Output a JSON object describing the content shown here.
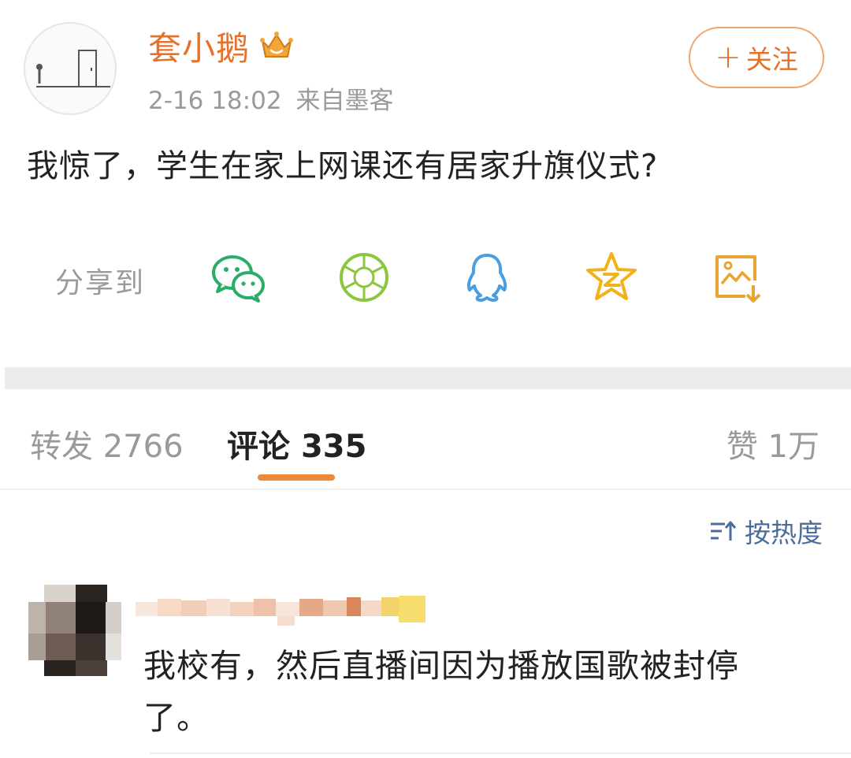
{
  "post": {
    "username": "套小鹅",
    "date": "2-16 18:02",
    "source": "来自墨客",
    "follow_label": "关注",
    "text": "我惊了，学生在家上网课还有居家升旗仪式?",
    "share_label": "分享到",
    "share_targets": [
      "wechat-icon",
      "moments-icon",
      "qq-icon",
      "qzone-icon",
      "save-image-icon"
    ]
  },
  "tabs": {
    "repost_label": "转发",
    "repost_count": "2766",
    "comments_label": "评论",
    "comments_count": "335",
    "likes_label": "赞",
    "likes_count": "1万"
  },
  "sort_label": "按热度",
  "comment": {
    "text": "我校有，然后直播间因为播放国歌被封停了。"
  },
  "colors": {
    "accent": "#e8712a",
    "wechat": "#2aae67",
    "moments": "#8cc63f",
    "qq": "#4a9ee0",
    "qzone": "#f2b21a",
    "save": "#e9a531",
    "sort": "#4a6d9c"
  }
}
